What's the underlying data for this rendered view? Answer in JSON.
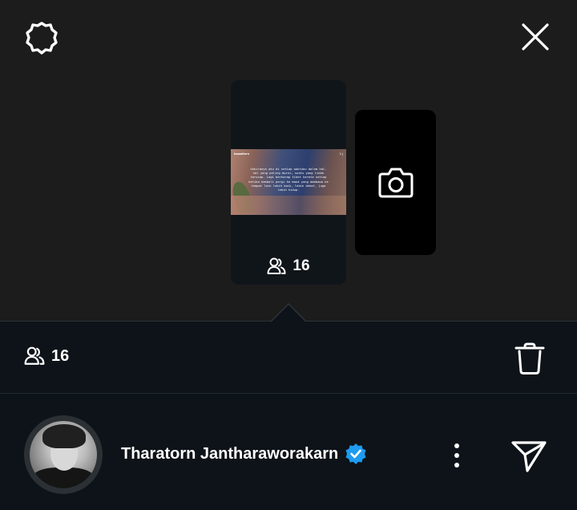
{
  "story": {
    "username": "kaaadtorn",
    "time": "1 j",
    "caption": "Sekiranya aku di setiap waktuku dalam hal-hal yang paling murni, suatu yang tidak terucap. Lagi berharap tiket kereta setiap ketika kembali pergi ke mana yang membawa ke tempat lain lebih baik, lebih dekat, juga lebih hidup.",
    "viewer_count": "16"
  },
  "bottom_bar": {
    "viewer_count": "16"
  },
  "profile": {
    "name": "Tharatorn Jantharaworakarn",
    "verified": true
  },
  "icons": {
    "settings": "gear-icon",
    "close": "close-icon",
    "camera": "camera-icon",
    "viewers": "viewers-icon",
    "trash": "trash-icon",
    "more": "more-vertical-icon",
    "send": "send-icon",
    "verified": "verified-badge-icon"
  },
  "colors": {
    "top_background": "#1c1c1d",
    "bottom_background": "#0d1318",
    "verified": "#1d9bf0"
  }
}
